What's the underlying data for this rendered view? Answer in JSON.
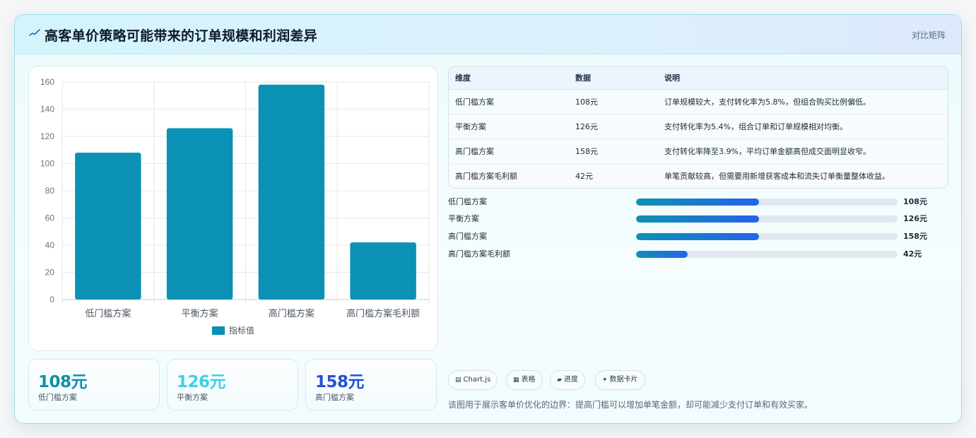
{
  "header": {
    "title": "高客单价策略可能带来的订单规模和利润差异",
    "tag": "对比矩阵",
    "logo_icon": "sparkline-icon"
  },
  "chart_data": {
    "type": "bar",
    "categories": [
      "低门槛方案",
      "平衡方案",
      "高门槛方案",
      "高门槛方案毛利额"
    ],
    "series": [
      {
        "name": "指标值",
        "values": [
          108,
          126,
          158,
          42
        ],
        "color": "#0a91b5"
      }
    ],
    "ylim": [
      0,
      160
    ],
    "yticks": [
      0,
      20,
      40,
      60,
      80,
      100,
      120,
      140,
      160
    ],
    "grid": true,
    "legend": "bottom"
  },
  "kpis": [
    {
      "value": "108元",
      "label": "低门槛方案",
      "color": "#0e8fae"
    },
    {
      "value": "126元",
      "label": "平衡方案",
      "color": "#3ecfe9"
    },
    {
      "value": "158元",
      "label": "高门槛方案",
      "color": "#2350d8"
    }
  ],
  "table": {
    "headers": [
      "维度",
      "数据",
      "说明"
    ],
    "rows": [
      [
        "低门槛方案",
        "108元",
        "订单规模较大，支付转化率为5.8%，但组合购买比例偏低。"
      ],
      [
        "平衡方案",
        "126元",
        "支付转化率为5.4%，组合订单和订单规模相对均衡。"
      ],
      [
        "高门槛方案",
        "158元",
        "支付转化率降至3.9%，平均订单金额高但成交面明显收窄。"
      ],
      [
        "高门槛方案毛利额",
        "42元",
        "单笔贡献较高，但需要用新增获客成本和流失订单衡量整体收益。"
      ]
    ]
  },
  "progress": [
    {
      "label": "低门槛方案",
      "value": "108元",
      "fraction": 0.47
    },
    {
      "label": "平衡方案",
      "value": "126元",
      "fraction": 0.47
    },
    {
      "label": "高门槛方案",
      "value": "158元",
      "fraction": 0.47
    },
    {
      "label": "高门槛方案毛利额",
      "value": "42元",
      "fraction": 0.197
    }
  ],
  "chips": [
    {
      "icon": "▤",
      "label": "Chart.js",
      "icon_name": "chart-icon"
    },
    {
      "icon": "▦",
      "label": "表格",
      "icon_name": "table-icon"
    },
    {
      "icon": "▰",
      "label": "进度",
      "icon_name": "progress-icon"
    },
    {
      "icon": "✦",
      "label": "数据卡片",
      "icon_name": "sparkle-icon"
    }
  ],
  "note": "该图用于展示客单价优化的边界：提高门槛可以增加单笔金额，却可能减少支付订单和有效买家。"
}
